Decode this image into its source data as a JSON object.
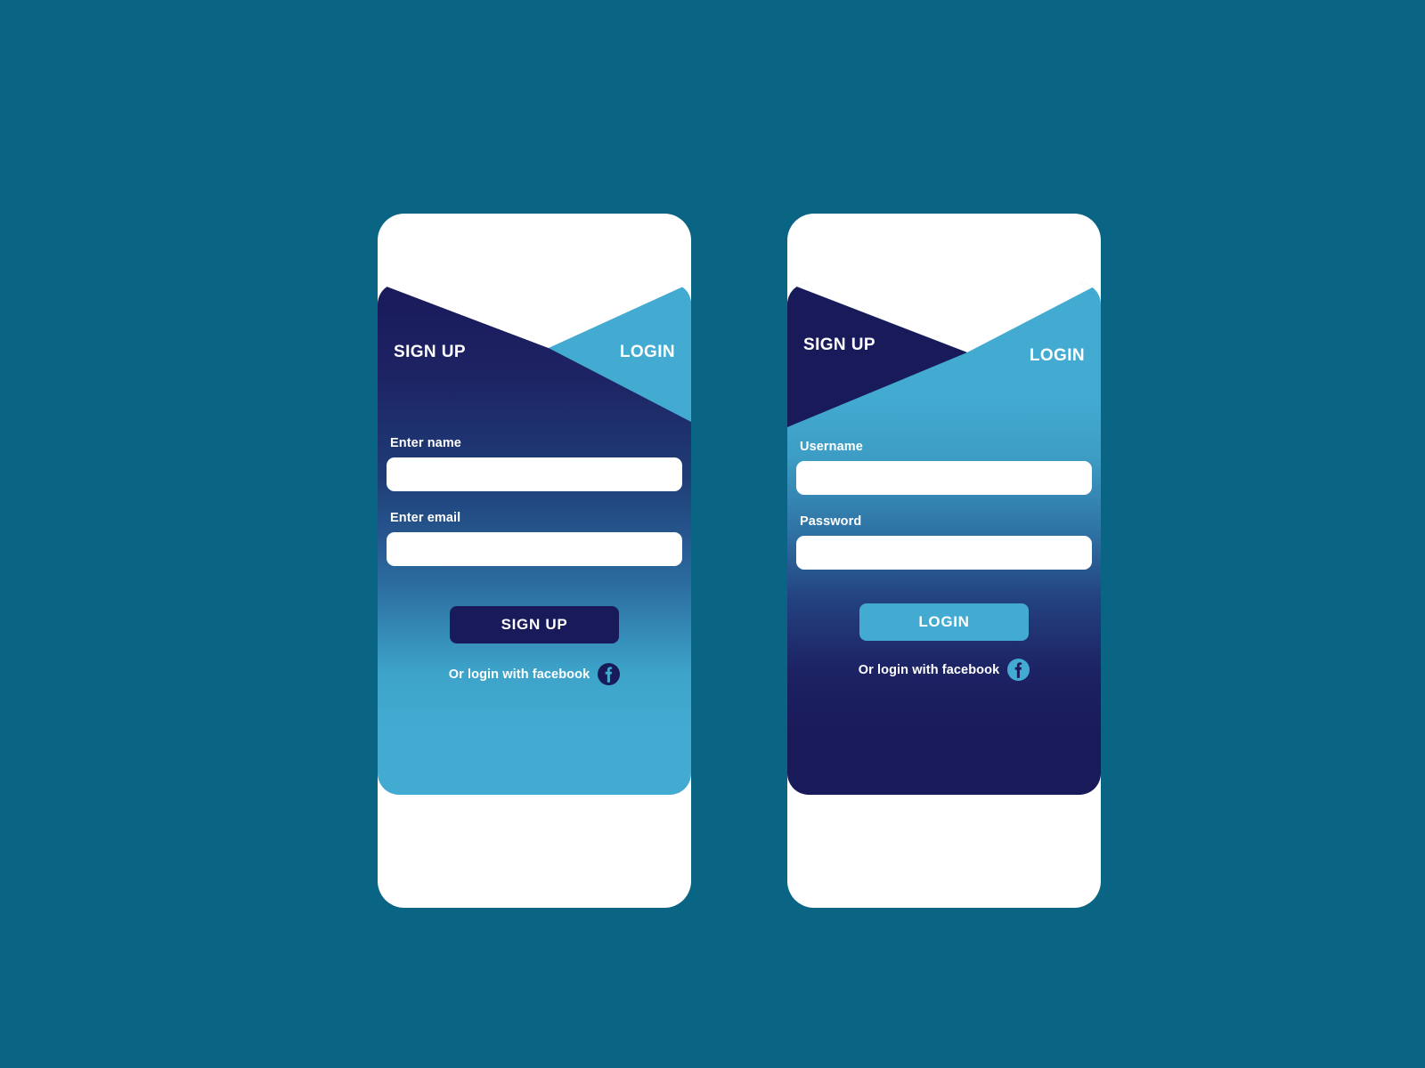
{
  "page": {
    "background_color": "#0a6584",
    "title": "Sign Up / Login mobile app screens"
  },
  "theme": {
    "navy": "#191a5a",
    "light_blue": "#43abd2",
    "white": "#ffffff",
    "page_teal": "#0a6584"
  },
  "screens": [
    {
      "id": "signup-screen",
      "name": "Sign Up screen",
      "active_tab": "SIGN UP",
      "tabs": [
        {
          "id": "signup",
          "label": "SIGN UP",
          "active": true
        },
        {
          "id": "login",
          "label": "LOGIN",
          "active": false
        }
      ],
      "fields": [
        {
          "id": "name",
          "label": "Enter name",
          "value": "",
          "placeholder": "",
          "type": "text"
        },
        {
          "id": "email",
          "label": "Enter email",
          "value": "",
          "placeholder": "",
          "type": "text"
        }
      ],
      "cta": {
        "label": "SIGN UP",
        "background": "#191a5a",
        "text_color": "#ffffff"
      },
      "social": {
        "label": "Or login with facebook",
        "icon": "facebook-icon",
        "icon_circle_color": "#191a5a",
        "icon_glyph_color": "#43abd2"
      }
    },
    {
      "id": "login-screen",
      "name": "Login screen",
      "active_tab": "LOGIN",
      "tabs": [
        {
          "id": "signup",
          "label": "SIGN UP",
          "active": false
        },
        {
          "id": "login",
          "label": "LOGIN",
          "active": true
        }
      ],
      "fields": [
        {
          "id": "username",
          "label": "Username",
          "value": "",
          "placeholder": "",
          "type": "text"
        },
        {
          "id": "password",
          "label": "Password",
          "value": "",
          "placeholder": "",
          "type": "password"
        }
      ],
      "cta": {
        "label": "LOGIN",
        "background": "#43abd2",
        "text_color": "#ffffff"
      },
      "social": {
        "label": "Or login with facebook",
        "icon": "facebook-icon",
        "icon_circle_color": "#43abd2",
        "icon_glyph_color": "#191a5a"
      }
    }
  ]
}
